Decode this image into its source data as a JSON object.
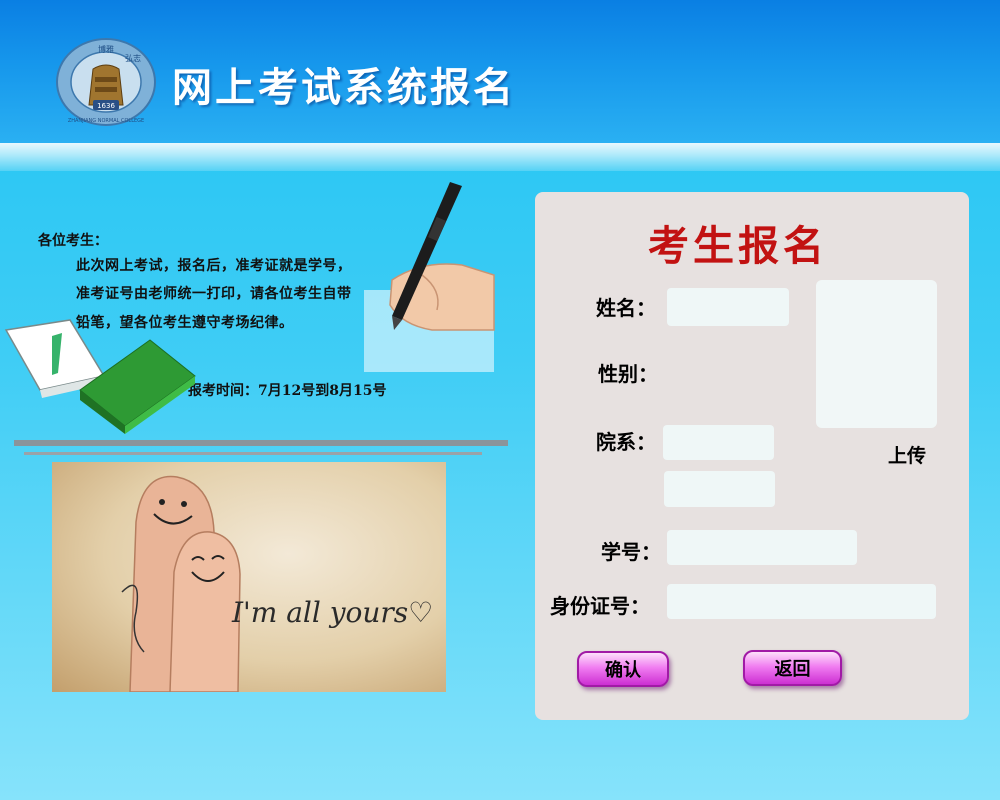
{
  "header": {
    "logo_text": [
      "博雅",
      "弘志",
      "1636",
      "ZHANJIANG NORMAL COLLEGE"
    ],
    "title": "网上考试系统报名"
  },
  "notice": {
    "heading": "各位考生：",
    "lines": [
      "此次网上考试，报名后，准考证就是学号，",
      "准考证号由老师统一打印，请各位考生自带",
      "铅笔，望各位考生遵守考场纪律。"
    ],
    "exam_period": "报考时间：7月12号到8月15号"
  },
  "photo": {
    "caption": "I'm all yours♡"
  },
  "registration": {
    "title": "考生报名",
    "labels": {
      "name": "姓名：",
      "gender": "性别：",
      "department": "院系：",
      "student_id": "学号：",
      "id_card": "身份证号："
    },
    "values": {
      "name": "",
      "department": "",
      "major": "",
      "student_id": "",
      "id_card": ""
    },
    "upload_label": "上传",
    "confirm_label": "确认",
    "back_label": "返回"
  },
  "colors": {
    "header_blue": "#0a7fe3",
    "page_cyan": "#3fcdf5",
    "title_red": "#c21212",
    "panel_gray": "#e7e1e0",
    "button_magenta": "#e06ae4"
  }
}
